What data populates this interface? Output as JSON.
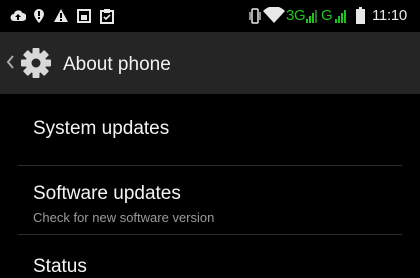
{
  "status_bar": {
    "left_icons": [
      "cloud-upload-icon",
      "location-pin-icon",
      "warning-icon",
      "screenshot-icon",
      "clipboard-icon"
    ],
    "right_icons": [
      "vibrate-icon",
      "wifi-icon",
      "signal-bars-icon",
      "battery-icon"
    ],
    "network_1": "3G",
    "network_2": "G",
    "time": "11:10",
    "accent_color": "#1ec41e"
  },
  "action_bar": {
    "title": "About phone",
    "icon": "gear-icon",
    "back_icon": "chevron-left-icon"
  },
  "list": {
    "items": [
      {
        "title": "System updates",
        "subtitle": ""
      },
      {
        "title": "Software updates",
        "subtitle": "Check for new software version"
      },
      {
        "title": "Status",
        "subtitle": ""
      }
    ]
  }
}
